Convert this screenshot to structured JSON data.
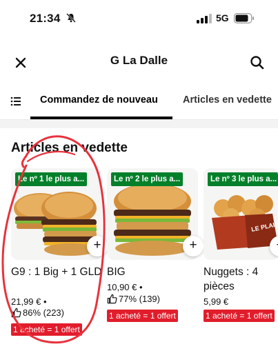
{
  "status_bar": {
    "time": "21:34",
    "network": "5G"
  },
  "header": {
    "title": "G La Dalle"
  },
  "tabs": {
    "active": "Commandez de nouveau",
    "inactive": "Articles en vedette"
  },
  "section": {
    "title": "Articles en vedette"
  },
  "colors": {
    "badge_green": "#05802a",
    "promo_red": "#e11d2c",
    "annotation_red": "#e8323c"
  },
  "cards": [
    {
      "badge": "Le nº 1 le plus a...",
      "name": "G9 : 1 Big + 1 GLD",
      "price": "21,99 € •",
      "rating": "86% (223)",
      "promo": "1 acheté = 1 offert"
    },
    {
      "badge": "Le nº 2 le plus a...",
      "name": "BIG",
      "price": "10,90 € •",
      "rating": "77% (139)",
      "promo": "1 acheté = 1 offert"
    },
    {
      "badge": "Le nº 3 le plus a...",
      "name": "Nuggets : 4 pièces",
      "price": "5,99 €",
      "rating": "",
      "promo": "1 acheté = 1 offert"
    }
  ],
  "image_text": {
    "box_text": "LE PLAISIR"
  }
}
